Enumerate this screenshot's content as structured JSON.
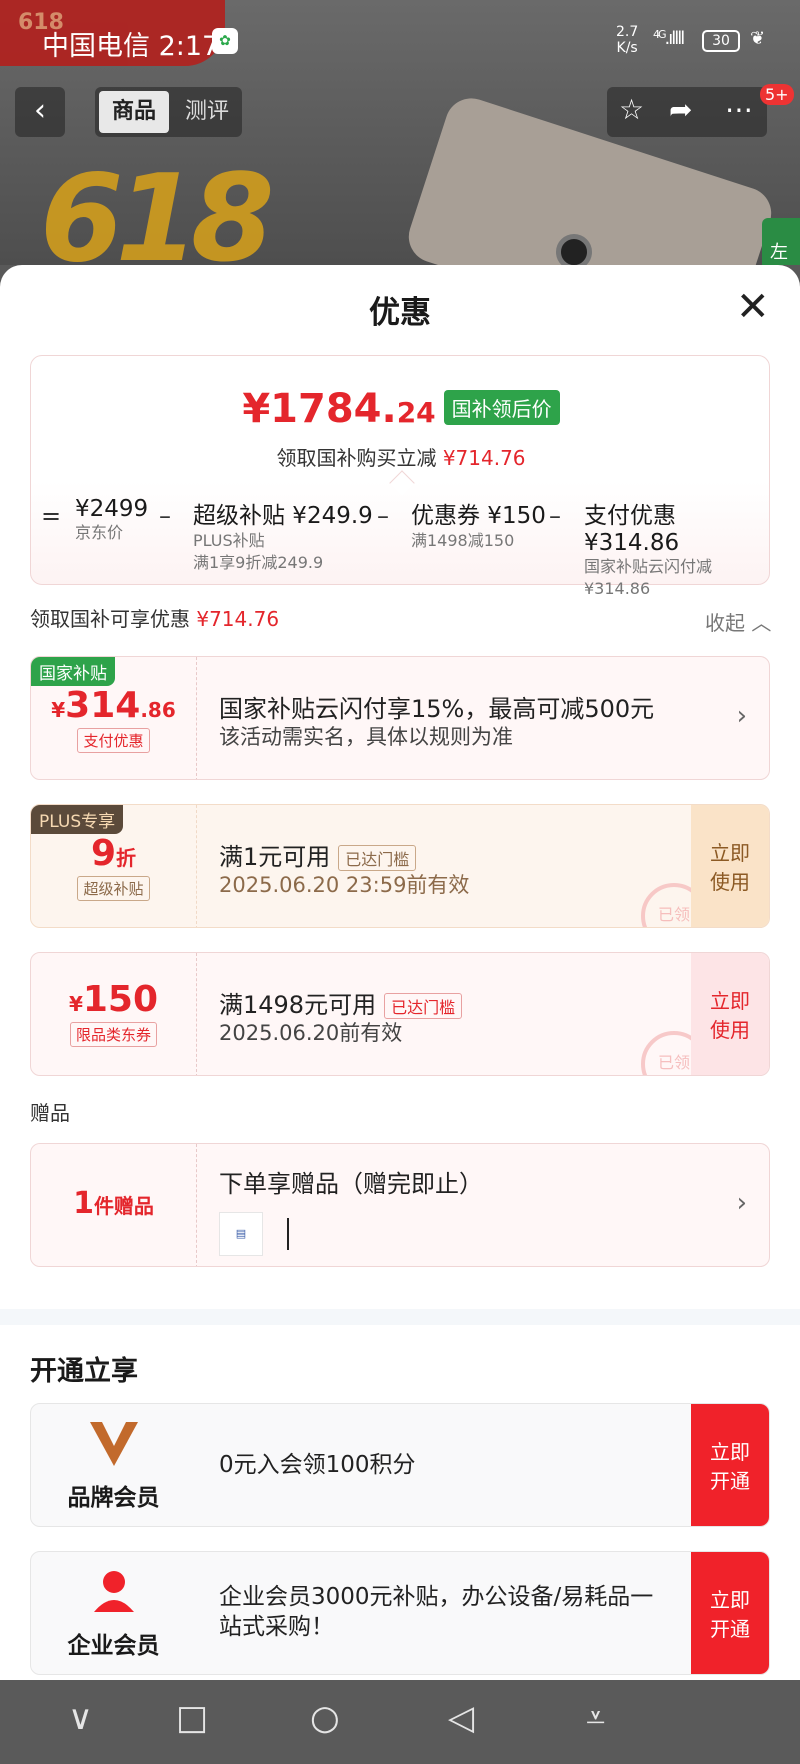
{
  "status_bar": {
    "carrier": "中国电信 2:17",
    "net_speed": "2.7",
    "net_unit": "K/s",
    "signal": "4G",
    "battery": "30"
  },
  "top_nav": {
    "back_label": "‹",
    "tab_goods": "商品",
    "tab_review": "测评",
    "badge": "5+"
  },
  "background": {
    "banner_text": "618",
    "side_tab": "左"
  },
  "sheet": {
    "title": "优惠",
    "close_label": "✕"
  },
  "summary": {
    "final_price_int": "¥1784.",
    "final_price_dec": "24",
    "price_tag": "国补领后价",
    "subtitle_prefix": "领取国补购买立减",
    "subtitle_amount": "¥714.76",
    "eq": "=",
    "items": [
      {
        "value": "¥2499",
        "name": "京东价",
        "note1": "",
        "note2": ""
      },
      {
        "value": "超级补贴 ¥249.9",
        "name": "PLUS补贴",
        "note1": "满1享9折减249.9",
        "note2": ""
      },
      {
        "value": "优惠券 ¥150",
        "name": "满1498减150",
        "note1": "",
        "note2": ""
      },
      {
        "value": "支付优惠 ¥314.86",
        "name": "国家补贴云闪付减",
        "note1": "¥314.86",
        "note2": ""
      }
    ],
    "minus": "–"
  },
  "discount_section": {
    "label": "领取国补可享优惠",
    "amount": "¥714.76",
    "collapse": "收起 ︿"
  },
  "coupons": [
    {
      "corner": "国家补贴",
      "currency": "¥",
      "amount": "314",
      "amount_dec": ".86",
      "tag": "支付优惠",
      "line1": "国家补贴云闪付享15%，最高可减500元",
      "line2": "该活动需实名，具体以规则为准",
      "chevron": "›"
    },
    {
      "corner": "PLUS专享",
      "amount": "9",
      "unit": "折",
      "tag": "超级补贴",
      "line1": "满1元可用",
      "pill": "已达门槛",
      "line2": "2025.06.20 23:59前有效",
      "use": [
        "立即",
        "使用"
      ],
      "stamp": "已领"
    },
    {
      "currency": "¥",
      "amount": "150",
      "tag": "限品类东券",
      "line1": "满1498元可用",
      "pill": "已达门槛",
      "line2": "2025.06.20前有效",
      "use": [
        "立即",
        "使用"
      ],
      "stamp": "已领"
    }
  ],
  "gift": {
    "section": "赠品",
    "count": "1",
    "count_unit": "件赠品",
    "line1": "下单享赠品（赠完即止）",
    "chevron": "›"
  },
  "membership": {
    "title": "开通立享",
    "items": [
      {
        "name": "品牌会员",
        "desc": "0元入会领100积分",
        "cta": [
          "立即",
          "开通"
        ]
      },
      {
        "name": "企业会员",
        "desc": "企业会员3000元补贴，办公设备/易耗品一站式采购！",
        "cta": [
          "立即",
          "开通"
        ]
      }
    ]
  },
  "colors": {
    "accent": "#e4262c",
    "green": "#2ea34a",
    "cta": "#f0222a",
    "plus_brown": "#5b4a3a"
  }
}
